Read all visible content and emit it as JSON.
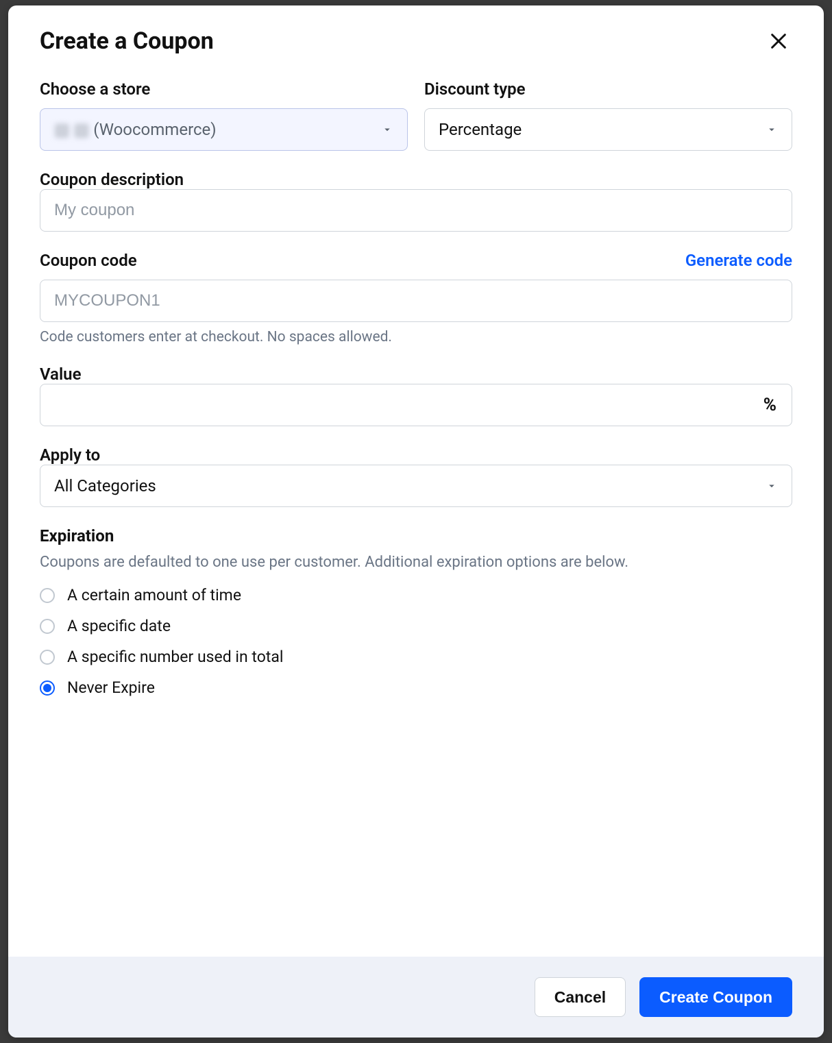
{
  "modal": {
    "title": "Create a Coupon"
  },
  "store": {
    "label": "Choose a store",
    "value_prefix": "▧ ▧",
    "value_suffix": "(Woocommerce)"
  },
  "discount_type": {
    "label": "Discount type",
    "value": "Percentage"
  },
  "description": {
    "label": "Coupon description",
    "placeholder": "My coupon",
    "value": ""
  },
  "code": {
    "label": "Coupon code",
    "generate_link": "Generate code",
    "placeholder": "MYCOUPON1",
    "value": "",
    "help": "Code customers enter at checkout. No spaces allowed."
  },
  "value": {
    "label": "Value",
    "value": "",
    "suffix": "%"
  },
  "apply_to": {
    "label": "Apply to",
    "value": "All Categories"
  },
  "expiration": {
    "label": "Expiration",
    "sub": "Coupons are defaulted to one use per customer. Additional expiration options are below.",
    "options": [
      {
        "label": "A certain amount of time",
        "checked": false
      },
      {
        "label": "A specific date",
        "checked": false
      },
      {
        "label": "A specific number used in total",
        "checked": false
      },
      {
        "label": "Never Expire",
        "checked": true
      }
    ]
  },
  "footer": {
    "cancel": "Cancel",
    "create": "Create Coupon"
  }
}
